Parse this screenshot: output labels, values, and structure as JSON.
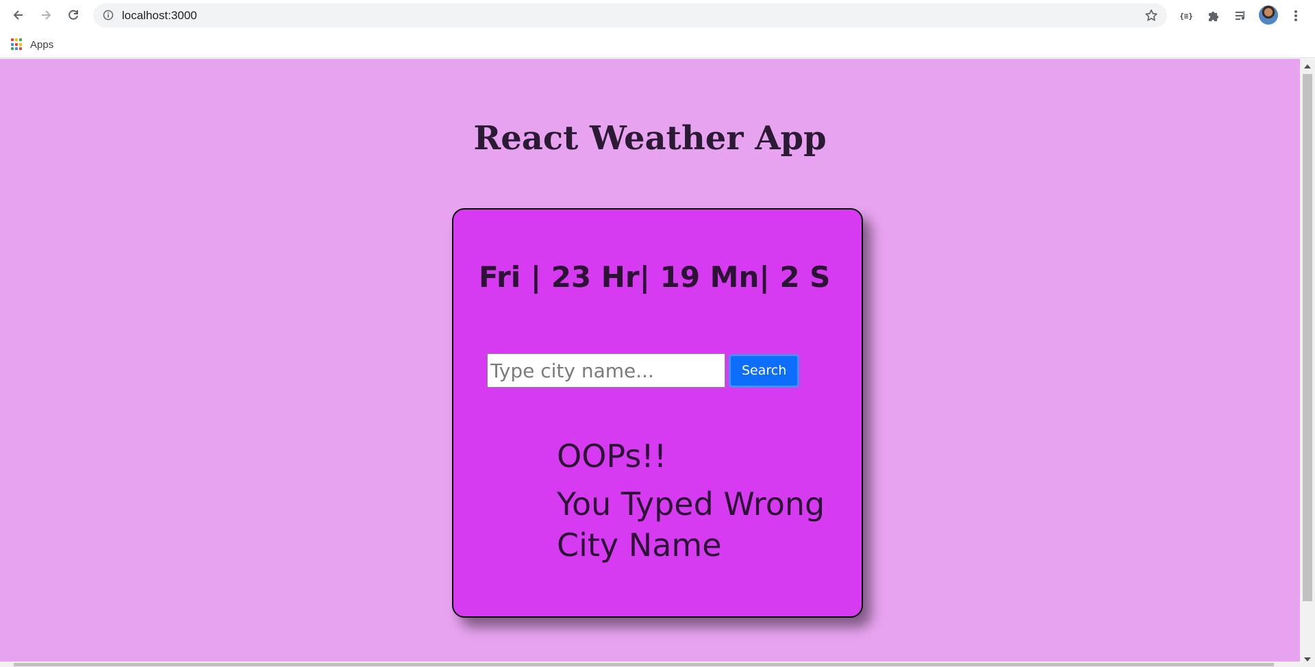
{
  "browser": {
    "url": "localhost:3000",
    "bookmarks": [
      {
        "label": "Apps",
        "icon": "apps-grid-icon"
      }
    ],
    "extensions": [
      "json-viewer-icon",
      "puzzle-icon",
      "media-queue-icon"
    ],
    "colors": {
      "page_bg": "#e8a3f0",
      "card_bg": "#d63bf2",
      "button_bg": "#0d6efd"
    }
  },
  "app": {
    "title": "React Weather App",
    "clock": "Fri | 23 Hr| 19 Mn| 2 S",
    "search": {
      "placeholder": "Type city name...",
      "value": "",
      "button_label": "Search"
    },
    "error": {
      "title": "OOPs!!",
      "message": "You Typed Wrong City Name"
    }
  }
}
